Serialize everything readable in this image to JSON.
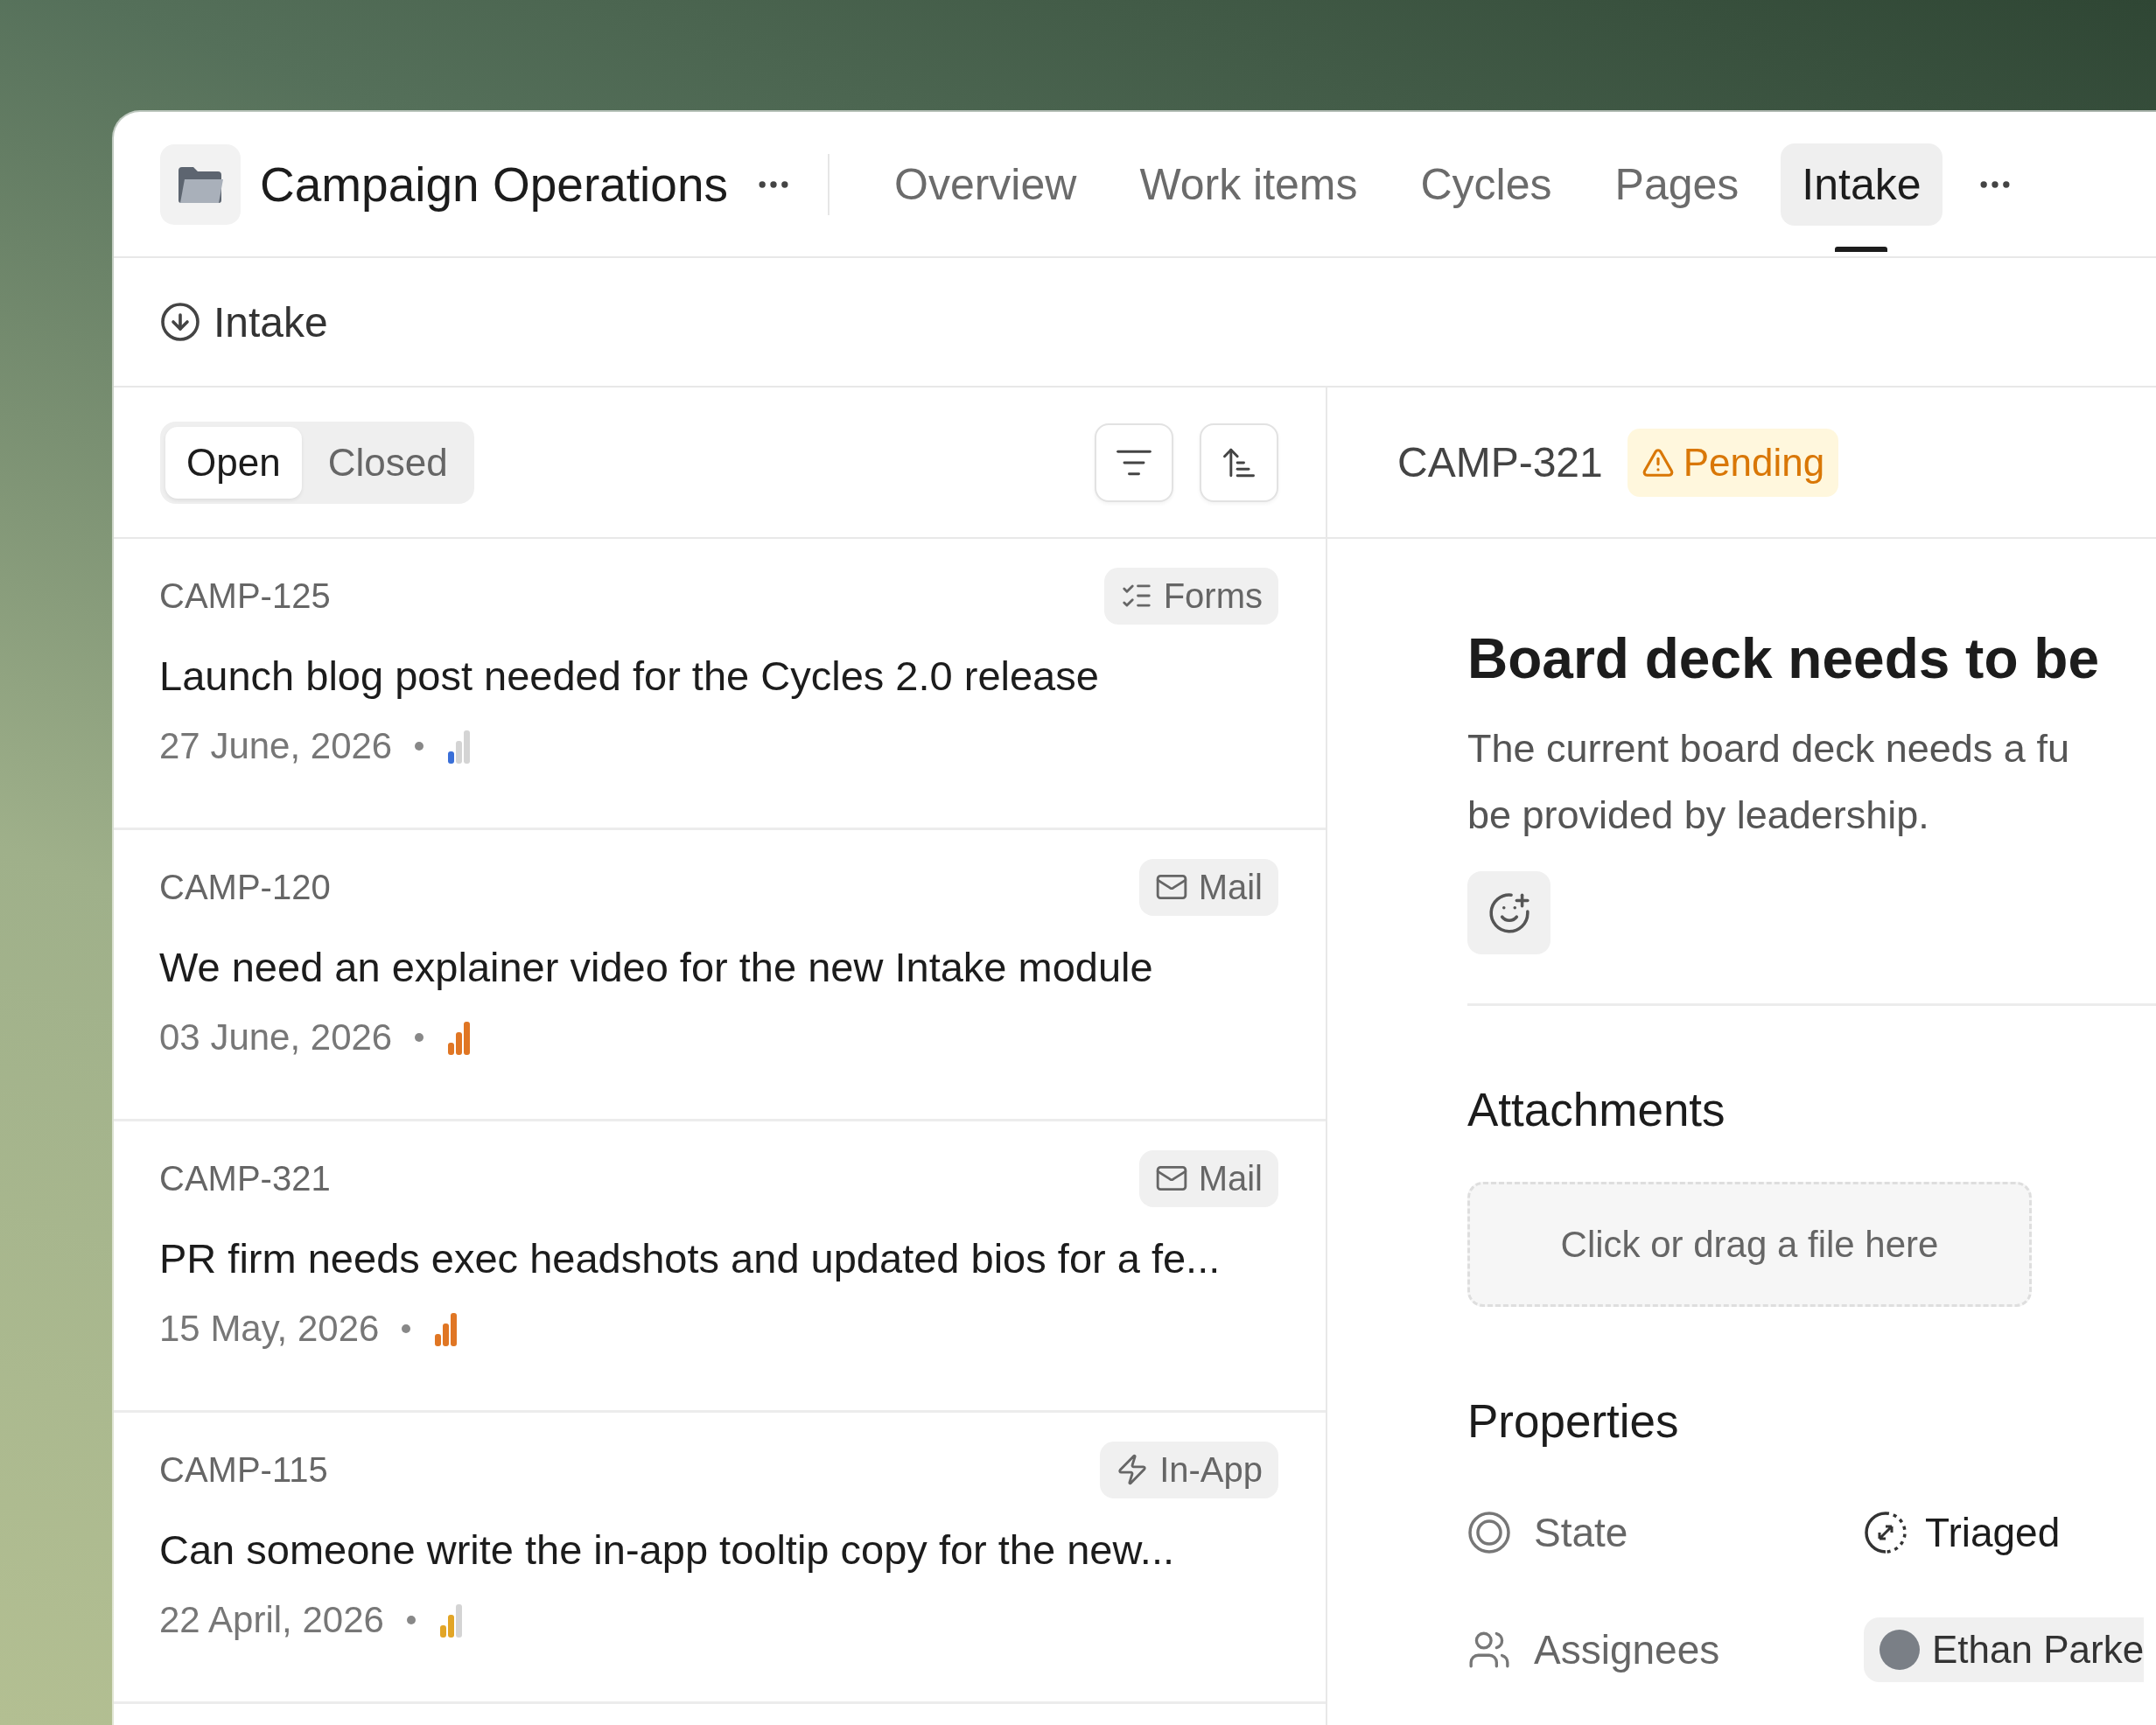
{
  "project": {
    "name": "Campaign Operations"
  },
  "nav": [
    {
      "label": "Overview",
      "selected": false
    },
    {
      "label": "Work items",
      "selected": false
    },
    {
      "label": "Cycles",
      "selected": false
    },
    {
      "label": "Pages",
      "selected": false
    },
    {
      "label": "Intake",
      "selected": true
    }
  ],
  "page_header": {
    "title": "Intake"
  },
  "filter_tabs": [
    {
      "label": "Open",
      "selected": true
    },
    {
      "label": "Closed",
      "selected": false
    }
  ],
  "items": [
    {
      "id": "CAMP-125",
      "source": {
        "kind": "forms",
        "label": "Forms"
      },
      "title": "Launch blog post needed for the Cycles 2.0 release",
      "date": "27 June, 2026",
      "level": 0.33,
      "color": "#3a6fd8"
    },
    {
      "id": "CAMP-120",
      "source": {
        "kind": "mail",
        "label": "Mail"
      },
      "title": "We need an explainer video for the new Intake module",
      "date": "03 June, 2026",
      "level": 1,
      "color": "#e07624"
    },
    {
      "id": "CAMP-321",
      "source": {
        "kind": "mail",
        "label": "Mail"
      },
      "title": "PR firm needs exec headshots and updated bios for a fe...",
      "date": "15 May, 2026",
      "level": 1,
      "color": "#e07624"
    },
    {
      "id": "CAMP-115",
      "source": {
        "kind": "in-app",
        "label": "In-App"
      },
      "title": "Can someone write the in-app tooltip copy for the new...",
      "date": "22 April, 2026",
      "level": 0.67,
      "color": "#e2a526"
    }
  ],
  "detail": {
    "id": "CAMP-321",
    "status": {
      "kind": "warning",
      "label": "Pending"
    },
    "title": "Board deck needs to be",
    "description_lines": [
      "The current board deck needs a fu",
      "be provided by leadership."
    ],
    "attachments": {
      "heading": "Attachments",
      "dropzone_text": "Click or drag a file here"
    },
    "properties": {
      "heading": "Properties",
      "rows": [
        {
          "kind": "state",
          "label": "State",
          "value": "Triaged"
        },
        {
          "kind": "assignee",
          "label": "Assignees",
          "value": "Ethan Parke"
        }
      ]
    }
  }
}
